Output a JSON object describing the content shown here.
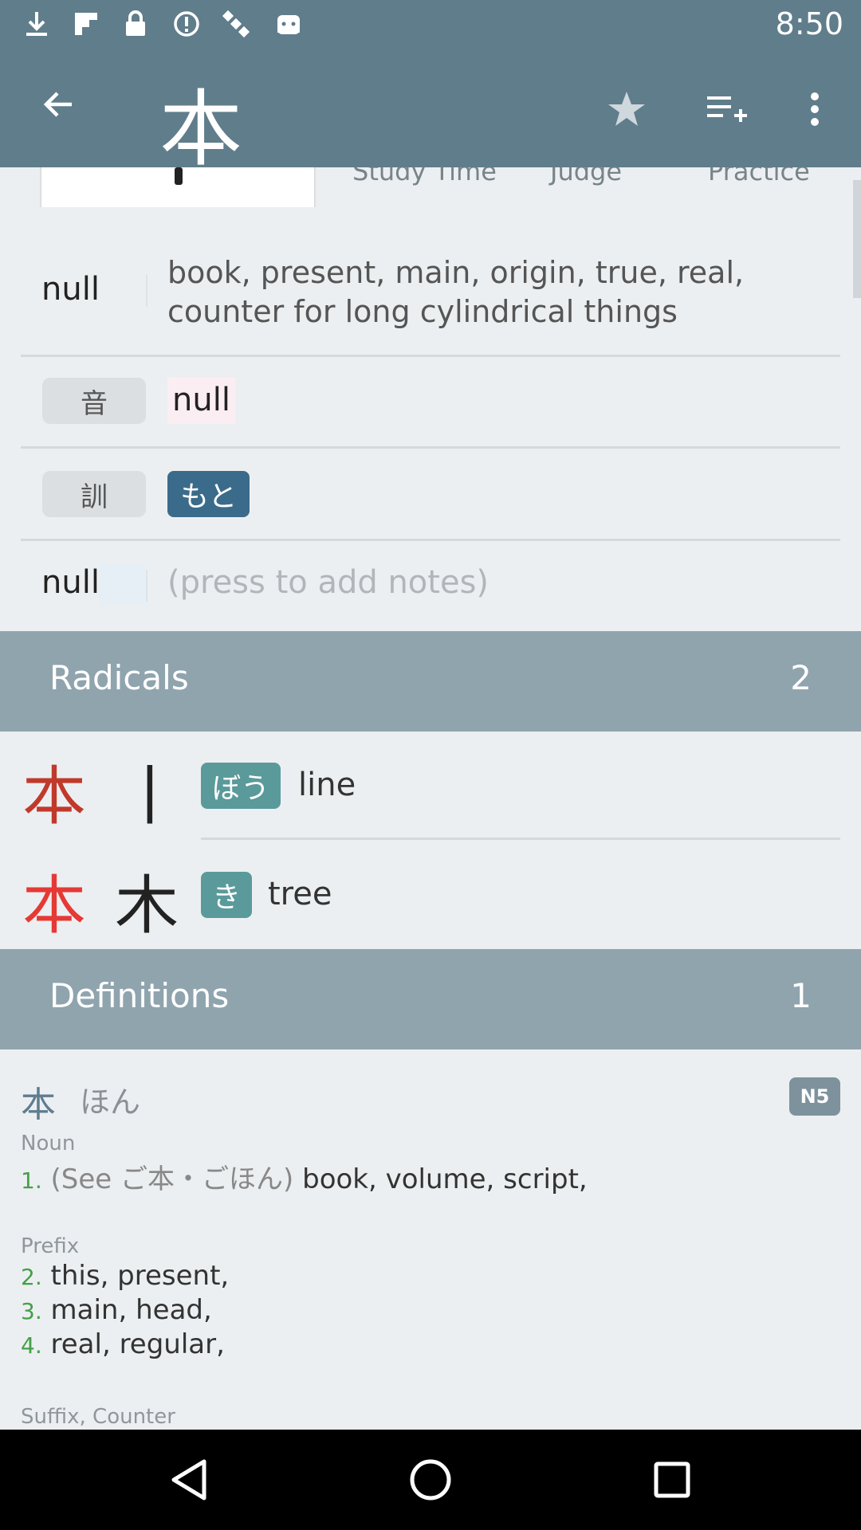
{
  "status_bar": {
    "time": "8:50",
    "icons": [
      "download-icon",
      "flipboard-icon",
      "lock-icon",
      "circle-exclamation-icon",
      "satellite-icon",
      "android-icon"
    ]
  },
  "app_bar": {
    "title": "本",
    "actions": [
      "back-arrow-icon",
      "star-icon",
      "playlist-add-icon",
      "more-vert-icon"
    ]
  },
  "tabs": {
    "study_time": "Study Time",
    "judge": "Judge",
    "practice": "Practice"
  },
  "info": {
    "meaning_label": "null",
    "meaning": "book, present, main, origin, true, real, counter for long cylindrical things",
    "on_label": "音",
    "on_value": "null",
    "kun_label": "訓",
    "kun_value": "もと",
    "notes_label": "null",
    "notes_placeholder": "(press to add notes)"
  },
  "radicals": {
    "header": "Radicals",
    "count": "2",
    "items": [
      {
        "kanji": "本",
        "part": "丨",
        "reading": "ぼう",
        "meaning": "line"
      },
      {
        "kanji": "本",
        "part": "木",
        "reading": "き",
        "meaning": "tree"
      }
    ]
  },
  "definitions": {
    "header": "Definitions",
    "count": "1",
    "word": "本",
    "reading": "ほん",
    "level": "N5",
    "groups": [
      {
        "pos": "Noun",
        "senses": [
          {
            "num": "1.",
            "xref": "(See ご本・ごほん)",
            "text": "book, volume, script,"
          }
        ]
      },
      {
        "pos": "Prefix",
        "senses": [
          {
            "num": "2.",
            "text": "this, present,"
          },
          {
            "num": "3.",
            "text": "main, head,"
          },
          {
            "num": "4.",
            "text": "real, regular,"
          }
        ]
      },
      {
        "pos": "Suffix, Counter",
        "senses": []
      }
    ]
  },
  "nav_bar": [
    "back-triangle-icon",
    "home-circle-icon",
    "recents-square-icon"
  ]
}
